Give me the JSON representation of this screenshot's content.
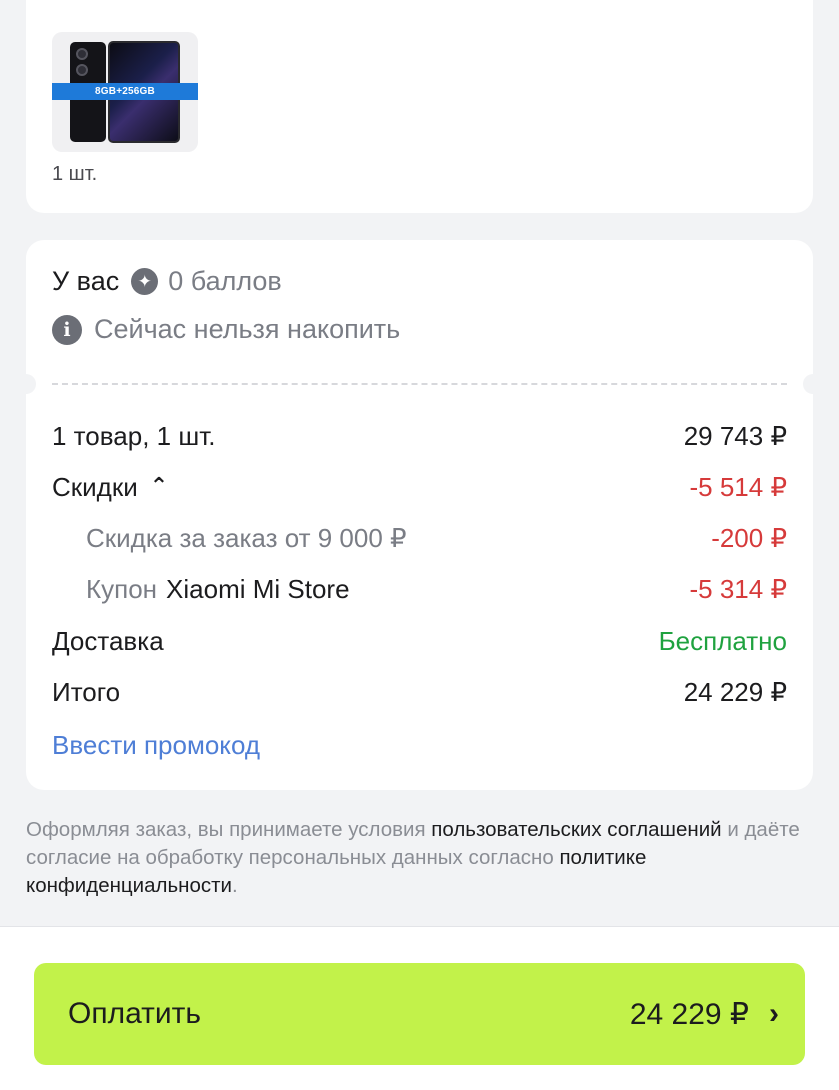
{
  "product": {
    "badge": "8GB+256GB",
    "quantity": "1 шт."
  },
  "bonus": {
    "prefix": "У вас",
    "points": "0 баллов",
    "note": "Сейчас нельзя накопить"
  },
  "summary": {
    "items_label": "1 товар, 1 шт.",
    "items_price": "29 743 ₽",
    "discounts_label": "Скидки",
    "discounts_value": "-5 514 ₽",
    "order_discount_label": "Скидка за заказ от 9 000 ₽",
    "order_discount_value": "-200 ₽",
    "coupon_label_prefix": "Купон",
    "coupon_label_name": "Xiaomi Mi Store",
    "coupon_value": "-5 314 ₽",
    "delivery_label": "Доставка",
    "delivery_value": "Бесплатно",
    "total_label": "Итого",
    "total_value": "24 229 ₽",
    "promo_link": "Ввести промокод"
  },
  "legal": {
    "part1": "Оформляя заказ, вы принимаете условия ",
    "link1": "пользовательских соглашений",
    "part2": " и даёте согласие на обработку персональных данных согласно ",
    "link2": "политике конфиденциальности",
    "part3": "."
  },
  "pay": {
    "label": "Оплатить",
    "amount": "24 229 ₽"
  },
  "colors": {
    "accent_green_button": "#c2f24a",
    "discount_red": "#d63a3a",
    "free_green": "#1fa23f",
    "link_blue": "#4e7ed6"
  },
  "icons": {
    "bonus": "bonus-coin-icon",
    "info": "info-icon",
    "discount_toggle": "chevron-up-icon",
    "pay_arrow": "chevron-right-icon"
  }
}
